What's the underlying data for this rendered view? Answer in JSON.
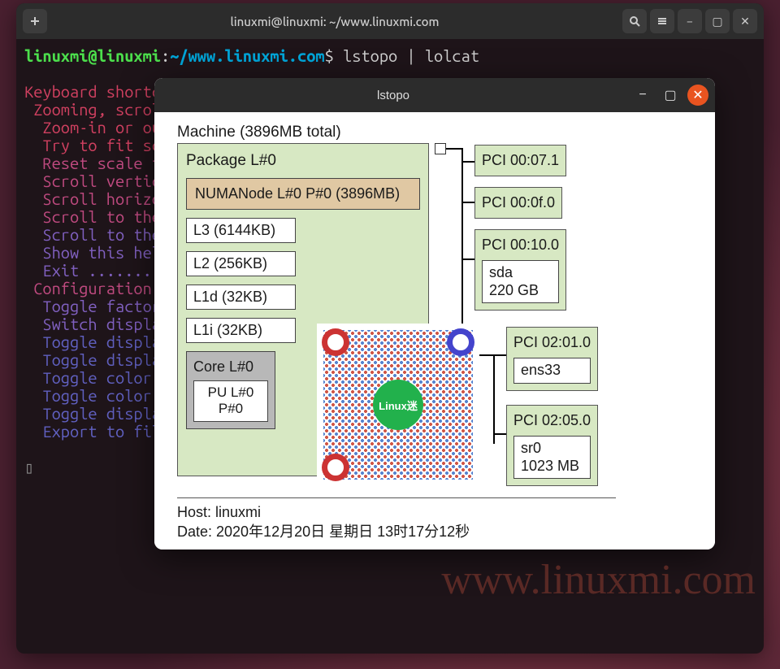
{
  "terminal": {
    "title": "linuxmi@linuxmi: ~/www.linuxmi.com",
    "prompt": {
      "user": "linuxmi@linuxmi",
      "path": "~/www.linuxmi.com",
      "dollar": "$"
    },
    "command": "lstopo | lolcat",
    "lines": [
      "Keyboard shortcut",
      " Zooming, scrolli",
      "  Zoom-in or out ",
      "  Try to fit scal",
      "  Reset scale to ",
      "  Scroll vertical",
      "  Scroll horizont",
      "  Scroll to the t",
      "  Scroll to the b",
      "  Show this help ",
      "  Exit ..........",
      " Configuration tw",
      "  Toggle factoriz",
      "  Switch display ",
      "  Toggle displayi",
      "  Toggle displayi",
      "  Toggle color fo",
      "  Toggle color fo",
      "  Toggle displayi",
      "  Export to file "
    ]
  },
  "watermark": "www.linuxmi.com",
  "lstopo": {
    "title": "lstopo",
    "machine_label": "Machine (3896MB total)",
    "package_label": "Package L#0",
    "numa": "NUMANode L#0 P#0 (3896MB)",
    "caches": {
      "l3": "L3 (6144KB)",
      "l2": "L2 (256KB)",
      "l1d": "L1d (32KB)",
      "l1i": "L1i (32KB)"
    },
    "core_label": "Core L#0",
    "pu_line1": "PU L#0",
    "pu_line2": "P#0",
    "pci": [
      {
        "label": "PCI 00:07.1"
      },
      {
        "label": "PCI 00:0f.0"
      },
      {
        "label": "PCI 00:10.0",
        "dev_line1": "sda",
        "dev_line2": "220 GB"
      },
      {
        "label": "PCI 02:01.0",
        "dev_line1": "ens33"
      },
      {
        "label": "PCI 02:05.0",
        "dev_line1": "sr0",
        "dev_line2": "1023 MB"
      }
    ],
    "footer": {
      "host": "Host: linuxmi",
      "date": "Date: 2020年12月20日 星期日 13时17分12秒"
    },
    "qr_label": "Linux迷"
  }
}
